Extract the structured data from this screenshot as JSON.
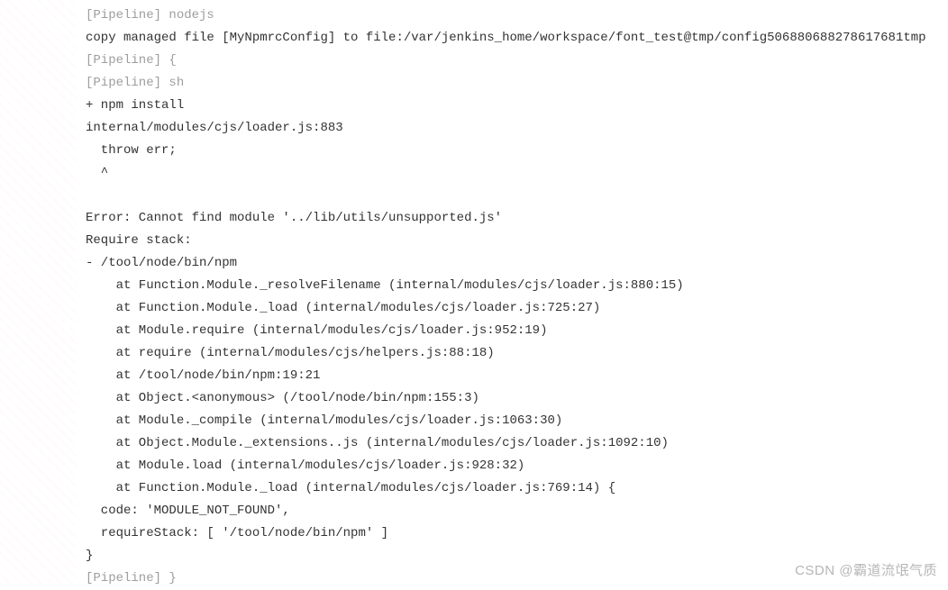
{
  "console": {
    "lines": [
      {
        "type": "pipeline",
        "text": "[Pipeline] nodejs"
      },
      {
        "type": "normal",
        "text": "copy managed file [MyNpmrcConfig] to file:/var/jenkins_home/workspace/font_test@tmp/config506880688278617681tmp"
      },
      {
        "type": "pipeline",
        "text": "[Pipeline] {"
      },
      {
        "type": "pipeline",
        "text": "[Pipeline] sh"
      },
      {
        "type": "normal",
        "text": "+ npm install"
      },
      {
        "type": "normal",
        "text": "internal/modules/cjs/loader.js:883"
      },
      {
        "type": "normal",
        "text": "  throw err;"
      },
      {
        "type": "normal",
        "text": "  ^"
      },
      {
        "type": "normal",
        "text": ""
      },
      {
        "type": "normal",
        "text": "Error: Cannot find module '../lib/utils/unsupported.js'"
      },
      {
        "type": "normal",
        "text": "Require stack:"
      },
      {
        "type": "normal",
        "text": "- /tool/node/bin/npm"
      },
      {
        "type": "normal",
        "text": "    at Function.Module._resolveFilename (internal/modules/cjs/loader.js:880:15)"
      },
      {
        "type": "normal",
        "text": "    at Function.Module._load (internal/modules/cjs/loader.js:725:27)"
      },
      {
        "type": "normal",
        "text": "    at Module.require (internal/modules/cjs/loader.js:952:19)"
      },
      {
        "type": "normal",
        "text": "    at require (internal/modules/cjs/helpers.js:88:18)"
      },
      {
        "type": "normal",
        "text": "    at /tool/node/bin/npm:19:21"
      },
      {
        "type": "normal",
        "text": "    at Object.<anonymous> (/tool/node/bin/npm:155:3)"
      },
      {
        "type": "normal",
        "text": "    at Module._compile (internal/modules/cjs/loader.js:1063:30)"
      },
      {
        "type": "normal",
        "text": "    at Object.Module._extensions..js (internal/modules/cjs/loader.js:1092:10)"
      },
      {
        "type": "normal",
        "text": "    at Module.load (internal/modules/cjs/loader.js:928:32)"
      },
      {
        "type": "normal",
        "text": "    at Function.Module._load (internal/modules/cjs/loader.js:769:14) {"
      },
      {
        "type": "normal",
        "text": "  code: 'MODULE_NOT_FOUND',"
      },
      {
        "type": "normal",
        "text": "  requireStack: [ '/tool/node/bin/npm' ]"
      },
      {
        "type": "normal",
        "text": "}"
      },
      {
        "type": "pipeline",
        "text": "[Pipeline] }"
      }
    ]
  },
  "watermark": "CSDN @霸道流氓气质"
}
